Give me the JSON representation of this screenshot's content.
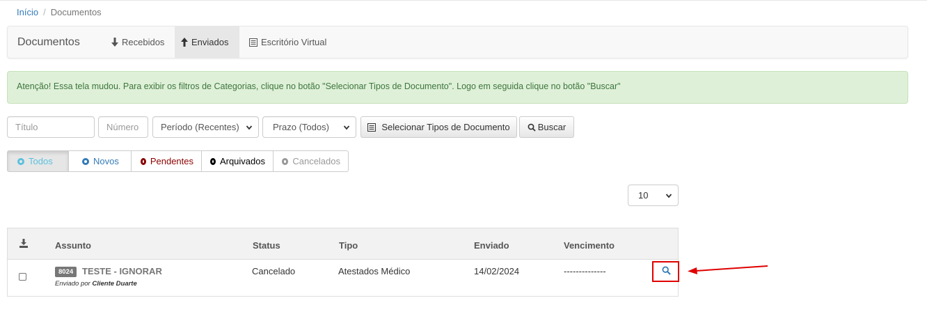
{
  "breadcrumb": {
    "home": "Início",
    "separator": "/",
    "current": "Documentos"
  },
  "navbar": {
    "brand": "Documentos",
    "tabs": [
      {
        "label": "Recebidos",
        "icon": "arrow-down-icon",
        "active": false
      },
      {
        "label": "Enviados",
        "icon": "arrow-up-icon",
        "active": true
      },
      {
        "label": "Escritório Virtual",
        "icon": "list-icon",
        "active": false
      }
    ]
  },
  "alert": {
    "text": "Atenção! Essa tela mudou. Para exibir os filtros de Categorias, clique no botão \"Selecionar Tipos de Documento\". Logo em seguida clique no botão \"Buscar\""
  },
  "filters": {
    "title_placeholder": "Título",
    "number_placeholder": "Número",
    "period_value": "Período (Recentes)",
    "deadline_value": "Prazo (Todos)",
    "select_types_label": "Selecionar Tipos de Documento",
    "search_label": "Buscar"
  },
  "status_filters": [
    {
      "label": "Todos",
      "color": "#5bc0de",
      "active": true
    },
    {
      "label": "Novos",
      "color": "#337ab7",
      "active": false
    },
    {
      "label": "Pendentes",
      "color": "#8b0000",
      "active": false
    },
    {
      "label": "Arquivados",
      "color": "#000000",
      "active": false
    },
    {
      "label": "Cancelados",
      "color": "#999999",
      "active": false
    }
  ],
  "page_size": "10",
  "table": {
    "headers": {
      "subject": "Assunto",
      "status": "Status",
      "type": "Tipo",
      "sent": "Enviado",
      "due": "Vencimento"
    },
    "rows": [
      {
        "id": "8024",
        "subject": "TESTE - IGNORAR",
        "sent_by_prefix": "Enviado por",
        "sent_by": "Cliente Duarte",
        "status": "Cancelado",
        "type": "Atestados Médico",
        "sent": "14/02/2024",
        "due": "--------------"
      }
    ]
  },
  "colors": {
    "link": "#337ab7",
    "alert_bg": "#dff0d8",
    "alert_text": "#3c763d",
    "highlight": "#e00000"
  }
}
